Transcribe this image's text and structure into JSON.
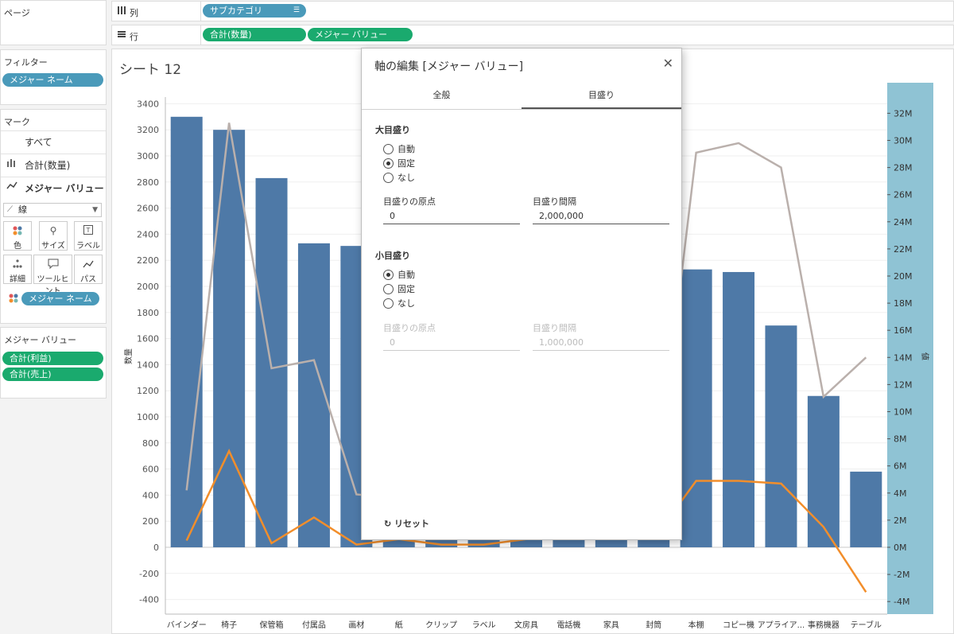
{
  "left_panel": {
    "pages_title": "ページ",
    "filters_title": "フィルター",
    "filter_pill": "メジャー ネーム",
    "marks_title": "マーク",
    "marks_rows": [
      {
        "label": "すべて",
        "icon": "none"
      },
      {
        "label": "合計(数量)",
        "icon": "bar-chart-icon"
      },
      {
        "label": "メジャー バリュー",
        "icon": "line-chart-icon"
      }
    ],
    "mark_type": "線",
    "mark_buttons": [
      {
        "label": "色",
        "icon": "color-icon"
      },
      {
        "label": "サイズ",
        "icon": "size-icon"
      },
      {
        "label": "ラベル",
        "icon": "label-icon"
      },
      {
        "label": "詳細",
        "icon": "detail-icon"
      },
      {
        "label": "ツールヒント",
        "icon": "tooltip-icon"
      },
      {
        "label": "パス",
        "icon": "path-icon"
      }
    ],
    "color_pill": "メジャー ネーム",
    "measure_values_title": "メジャー バリュー",
    "measure_pills": [
      "合計(利益)",
      "合計(売上)"
    ]
  },
  "shelves": {
    "columns_label": "列",
    "rows_label": "行",
    "column_pill": "サブカテゴリ",
    "row_pills": [
      "合計(数量)",
      "メジャー バリュー"
    ]
  },
  "sheet": {
    "title": "シート 12"
  },
  "chart_data": {
    "type": "bar",
    "categories": [
      "バインダー",
      "椅子",
      "保管箱",
      "付属品",
      "画材",
      "紙",
      "クリップ",
      "ラベル",
      "文房具",
      "電話機",
      "家具",
      "封筒",
      "本棚",
      "コピー機",
      "アプライア...",
      "事務機器",
      "テーブル"
    ],
    "ylabel": "数量",
    "y2label": "値",
    "ylim": [
      -500,
      3500
    ],
    "y2lim": [
      -5,
      33
    ],
    "left_ticks": [
      3400,
      3200,
      3000,
      2800,
      2600,
      2400,
      2200,
      2000,
      1800,
      1600,
      1400,
      1200,
      1000,
      800,
      600,
      400,
      200,
      0,
      -200,
      -400
    ],
    "right_ticks": [
      "32M",
      "30M",
      "28M",
      "26M",
      "24M",
      "22M",
      "20M",
      "18M",
      "16M",
      "14M",
      "12M",
      "10M",
      "8M",
      "6M",
      "4M",
      "2M",
      "0M",
      "-2M",
      "-4M"
    ],
    "series": [
      {
        "name": "合計(数量)",
        "type": "bar",
        "axis": "left",
        "color": "#4e79a7",
        "values": [
          3300,
          3200,
          2830,
          2330,
          2310,
          610,
          550,
          640,
          600,
          590,
          600,
          590,
          2130,
          2110,
          1700,
          1160,
          580
        ]
      },
      {
        "name": "合計(売上)",
        "type": "line",
        "axis": "right",
        "color": "#bab0ac",
        "values": [
          4.2,
          31.3,
          13.2,
          13.8,
          3.9,
          3.6,
          2.5,
          2.2,
          2.4,
          4.0,
          3.9,
          2.9,
          29.1,
          29.8,
          28.0,
          11.1,
          14.0
        ]
      },
      {
        "name": "合計(利益)",
        "type": "line",
        "axis": "right",
        "color": "#f28e2b",
        "values": [
          0.5,
          7.1,
          0.3,
          2.2,
          0.2,
          0.6,
          0.2,
          0.2,
          0.6,
          1.0,
          0.6,
          0.6,
          4.9,
          4.9,
          4.7,
          1.5,
          -3.3
        ]
      }
    ]
  },
  "dialog": {
    "title": "軸の編集 [メジャー バリュー]",
    "close_label": "✕",
    "tabs": [
      "全般",
      "目盛り"
    ],
    "active_tab": "目盛り",
    "major": {
      "title": "大目盛り",
      "options": [
        "自動",
        "固定",
        "なし"
      ],
      "selected": "固定",
      "origin_label": "目盛りの原点",
      "origin_value": "0",
      "interval_label": "目盛り間隔",
      "interval_value": "2,000,000"
    },
    "minor": {
      "title": "小目盛り",
      "options": [
        "自動",
        "固定",
        "なし"
      ],
      "selected": "自動",
      "origin_label": "目盛りの原点",
      "origin_value": "0",
      "interval_label": "目盛り間隔",
      "interval_value": "1,000,000"
    },
    "reset_label": "リセット"
  }
}
